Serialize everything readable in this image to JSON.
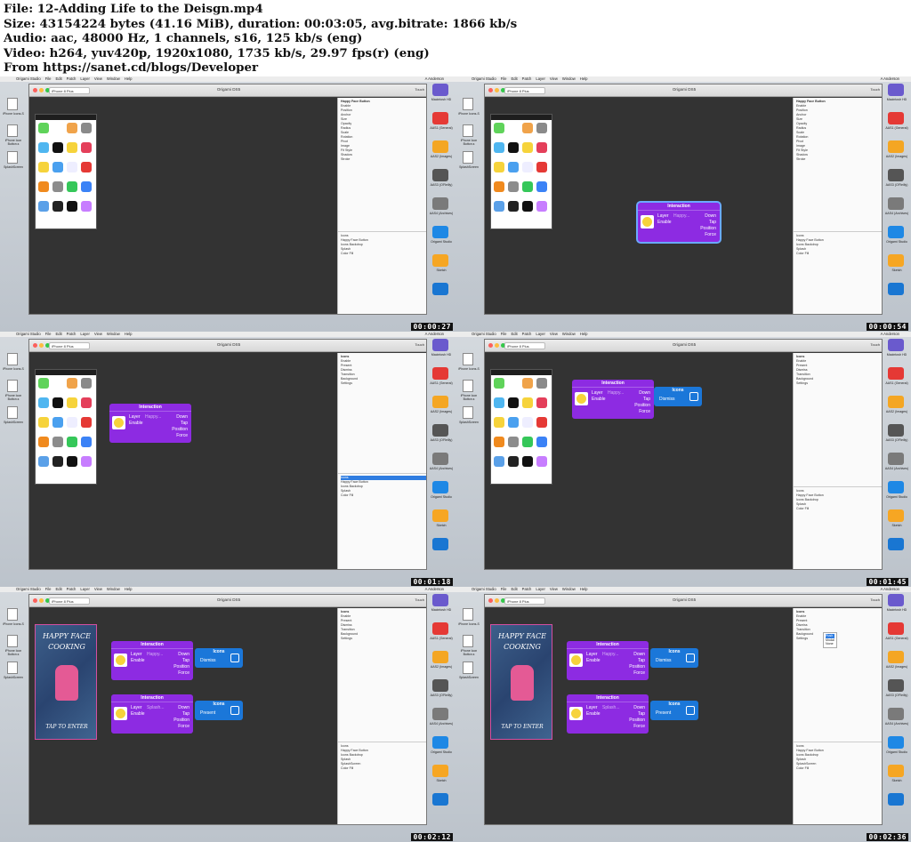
{
  "header": {
    "lines": [
      "File: 12-Adding Life to the Deisgn.mp4",
      "Size: 43154224 bytes (41.16 MiB), duration: 00:03:05, avg.bitrate: 1866 kb/s",
      "Audio: aac, 48000 Hz, 1 channels, s16, 125 kb/s (eng)",
      "Video: h264, yuv420p, 1920x1080, 1735 kb/s, 29.97 fps(r) (eng)",
      "From https://sanet.cd/blogs/Developer"
    ]
  },
  "app": {
    "name": "Origami Studio",
    "menus": [
      "File",
      "Edit",
      "Patch",
      "Layer",
      "View",
      "Window",
      "Help"
    ],
    "user": "A Anderson",
    "window_title": "Origami DS5",
    "device": "iPhone 8 Plus",
    "touch": "Touch"
  },
  "desktop": {
    "left_items": [
      "iPhone Icons-S",
      "iPhone Icon Button.s",
      "SplashScreen"
    ],
    "dock": [
      "Macintosh HD",
      "AAS1 (General)",
      "AAS2 (Images)",
      "AAS3 (O'Reilly)",
      "AAS4 (Archives)",
      "Origami Studio",
      "Sketch",
      ""
    ]
  },
  "inspector": {
    "title": "Happy Face Button",
    "props": [
      "Enable",
      "Position",
      "Anchor",
      "Size",
      "Opacity",
      "Radius",
      "Scale",
      "Rotation",
      "Pivot",
      "Image",
      "Fit Style"
    ],
    "icons_props": [
      "Enable",
      "Present",
      "Dismiss",
      "Transition",
      "Background"
    ],
    "section_shadow": "Shadow",
    "section_stroke": "Stroke",
    "section_settings": "Settings",
    "transition_value": "Push"
  },
  "layers": {
    "icons": "Icons",
    "happy": "Happy Face Button",
    "backdrop": "Icons Backdrop",
    "splash": "Splash",
    "splash_screen": "SplashScreen",
    "color_fill": "Color Fill",
    "present": "Present",
    "dismiss": "Dismiss"
  },
  "patches": {
    "interaction": "Interaction",
    "icons": "Icons",
    "layer": "Layer",
    "enable": "Enable",
    "down": "Down",
    "tap": "Tap",
    "position": "Position",
    "force": "Force",
    "dismiss": "Dismiss",
    "present": "Present",
    "happy_value": "Happy...",
    "splash_value": "Splash..."
  },
  "poster": {
    "line1": "HAPPY FACE",
    "line2": "COOKING",
    "line3": "TAP TO ENTER"
  },
  "popup_menu": [
    "Push",
    "Modal",
    "None"
  ],
  "timestamps": [
    "00:00:27",
    "00:00:54",
    "00:01:18",
    "00:01:45",
    "00:02:12",
    "00:02:36"
  ],
  "ios_date": "10"
}
